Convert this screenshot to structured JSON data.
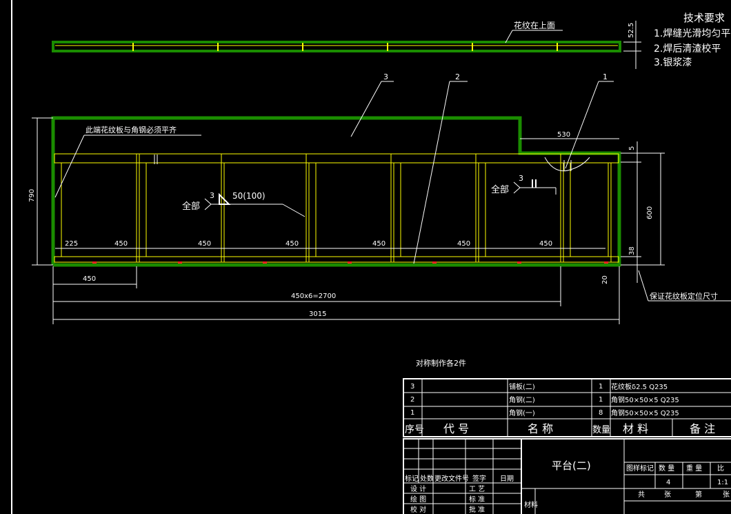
{
  "tech_requirements": {
    "title": "技术要求",
    "items": [
      "1.焊缝光滑均匀平",
      "2.焊后清渣校平",
      "3.银浆漆"
    ]
  },
  "callouts": {
    "pattern_on_top": "花纹在上面",
    "flush_note": "此端花纹板与角钢必须平齐",
    "ensure_position": "保证花纹板定位尺寸",
    "balloon_3": "3",
    "balloon_2": "2",
    "balloon_1": "1"
  },
  "weld_symbols": {
    "left_all": "全部",
    "left_leg": "3",
    "left_spec": "50(100)",
    "right_all": "全部",
    "right_leg": "3"
  },
  "dimensions": {
    "top_thickness": "52.5",
    "height_total": "790",
    "height_frame": "600",
    "dim_5": "5",
    "dim_530": "530",
    "dim_38": "38",
    "dim_20": "20",
    "first_225": "225",
    "pitch": [
      "450",
      "450",
      "450",
      "450",
      "450",
      "450"
    ],
    "bottom_450": "450",
    "pitch_total": "450x6=2700",
    "overall": "3015"
  },
  "note_symmetric": "对称制作各2件",
  "bom": {
    "rows": [
      {
        "no": "3",
        "code": "",
        "name": "铺板(二)",
        "qty": "1",
        "material": "花纹板δ2.5 Q235"
      },
      {
        "no": "2",
        "code": "",
        "name": "角钢(二)",
        "qty": "1",
        "material": "角钢50×50×5 Q235"
      },
      {
        "no": "1",
        "code": "",
        "name": "角钢(一)",
        "qty": "8",
        "material": "角钢50×50×5 Q235"
      }
    ],
    "header": {
      "no": "序号",
      "code": "代 号",
      "name": "名 称",
      "qty": "数量",
      "material": "材 料",
      "remark": "备 注"
    }
  },
  "title_block": {
    "drawing_name": "平台(二)",
    "rev_labels": [
      "标记",
      "处数",
      "更改文件号",
      "签字",
      "日期"
    ],
    "roles": [
      "设 计",
      "绘 图",
      "校 对"
    ],
    "roles2": [
      "工 艺",
      "标 准",
      "批 准"
    ],
    "stage_label": "图样标记",
    "qty_label": "数 量",
    "weight_label": "重 量",
    "scale_label": "比",
    "qty_value": "4",
    "scale_value": "1:1",
    "sheet_labels": [
      "共",
      "张",
      "第",
      "张"
    ],
    "material_label": "材料"
  },
  "colors": {
    "outline": "#1a8c00",
    "frame": "#ffff00",
    "lines": "#ffffff",
    "marks": "#ff2020"
  }
}
